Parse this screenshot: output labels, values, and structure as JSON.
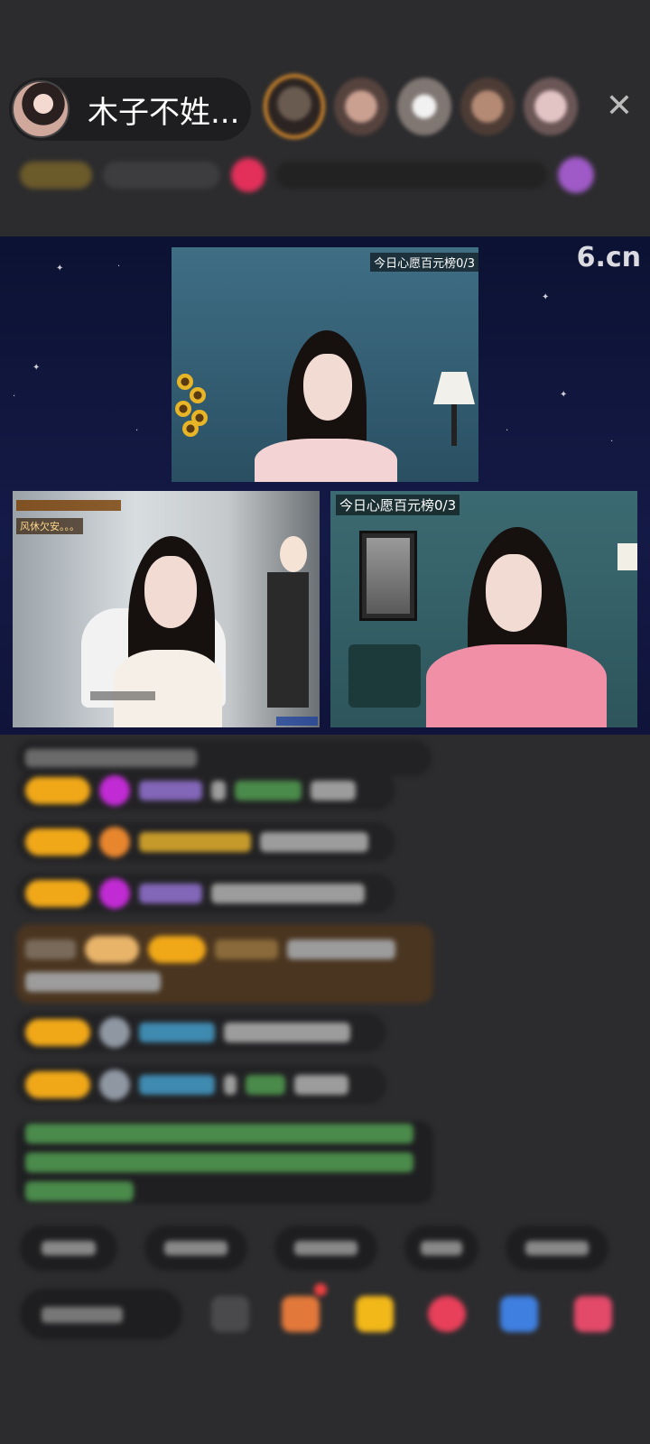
{
  "host": {
    "name": "木子不姓..."
  },
  "stream": {
    "watermark": "6.cn",
    "cams": [
      {
        "label": "今日心愿百元榜0/3"
      },
      {
        "label_top": "风休欠安。。。",
        "label_bottom": ""
      },
      {
        "label": "今日心愿百元榜0/3"
      }
    ]
  },
  "header": {
    "close_symbol": "✕"
  }
}
